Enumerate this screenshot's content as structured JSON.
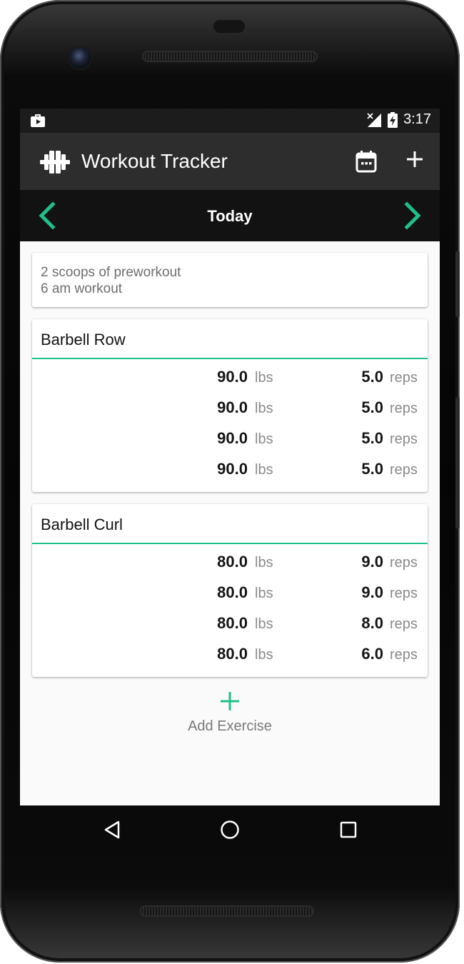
{
  "status_bar": {
    "time": "3:17",
    "icons": [
      "briefcase-icon",
      "no-signal-icon",
      "battery-charging-icon"
    ]
  },
  "app_bar": {
    "title": "Workout Tracker",
    "logo_icon": "dumbbell-icon",
    "actions": [
      "calendar-icon",
      "add-icon"
    ]
  },
  "date_bar": {
    "label": "Today",
    "prev_icon": "chevron-left-icon",
    "next_icon": "chevron-right-icon"
  },
  "notes": {
    "lines": [
      "2 scoops of preworkout",
      "6 am workout"
    ]
  },
  "exercises": [
    {
      "name": "Barbell Row",
      "sets": [
        {
          "weight": "90.0",
          "weight_unit": "lbs",
          "reps": "5.0",
          "reps_unit": "reps"
        },
        {
          "weight": "90.0",
          "weight_unit": "lbs",
          "reps": "5.0",
          "reps_unit": "reps"
        },
        {
          "weight": "90.0",
          "weight_unit": "lbs",
          "reps": "5.0",
          "reps_unit": "reps"
        },
        {
          "weight": "90.0",
          "weight_unit": "lbs",
          "reps": "5.0",
          "reps_unit": "reps"
        }
      ]
    },
    {
      "name": "Barbell Curl",
      "sets": [
        {
          "weight": "80.0",
          "weight_unit": "lbs",
          "reps": "9.0",
          "reps_unit": "reps"
        },
        {
          "weight": "80.0",
          "weight_unit": "lbs",
          "reps": "9.0",
          "reps_unit": "reps"
        },
        {
          "weight": "80.0",
          "weight_unit": "lbs",
          "reps": "8.0",
          "reps_unit": "reps"
        },
        {
          "weight": "80.0",
          "weight_unit": "lbs",
          "reps": "6.0",
          "reps_unit": "reps"
        }
      ]
    }
  ],
  "add_exercise": {
    "label": "Add Exercise",
    "icon": "plus-icon"
  },
  "nav_bar": [
    "back-icon",
    "home-icon",
    "recents-icon"
  ],
  "colors": {
    "accent": "#1fbf8a",
    "app_bar": "#2d2d2d",
    "date_bar": "#121212",
    "status_bar": "#1c1c1c",
    "background": "#fafafa"
  }
}
